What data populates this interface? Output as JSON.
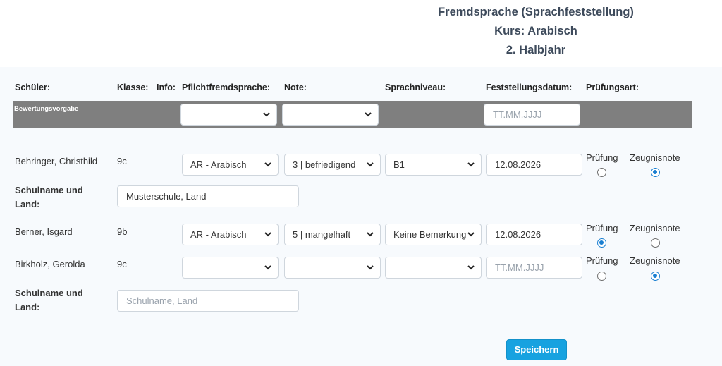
{
  "header": {
    "line1": "Fremdsprache (Sprachfeststellung)",
    "line2": "Kurs: Arabisch",
    "line3": "2. Halbjahr"
  },
  "columns": {
    "schueler": "Schüler:",
    "klasse": "Klasse:",
    "info": "Info:",
    "pflicht": "Pflichtfremdsprache:",
    "note": "Note:",
    "niveau": "Sprachniveau:",
    "datum": "Feststellungsdatum:",
    "art": "Prüfungsart:"
  },
  "vorgabe": {
    "label": "Bewertungsvorgabe",
    "pflicht": "",
    "note": "",
    "datum_placeholder": "TT.MM.JJJJ"
  },
  "radio_labels": {
    "pruefung": "Prüfung",
    "zeugnis": "Zeugnisnote"
  },
  "school_label_line1": "Schulname und",
  "school_label_line2": "Land:",
  "students": [
    {
      "name": "Behringer, Christhild",
      "klasse": "9c",
      "pflicht": "AR - Arabisch",
      "note": "3 | befriedigend",
      "niveau": "B1",
      "datum": "12.08.2026",
      "art": "zeugnis",
      "schule": "Musterschule, Land",
      "schule_placeholder": ""
    },
    {
      "name": "Berner, Isgard",
      "klasse": "9b",
      "pflicht": "AR - Arabisch",
      "note": "5 | mangelhaft",
      "niveau": "Keine Bemerkung",
      "datum": "12.08.2026",
      "art": "pruefung"
    },
    {
      "name": "Birkholz, Gerolda",
      "klasse": "9c",
      "pflicht": "",
      "note": "",
      "niveau": "",
      "datum": "",
      "datum_placeholder": "TT.MM.JJJJ",
      "art": "zeugnis",
      "schule": "",
      "schule_placeholder": "Schulname, Land"
    }
  ],
  "save_button": "Speichern",
  "icons": {
    "dropdown": "chevron-down-icon"
  },
  "colors": {
    "accent": "#17a2e0",
    "bar": "#7f7f7f",
    "radio_on": "#1a7fd1"
  }
}
